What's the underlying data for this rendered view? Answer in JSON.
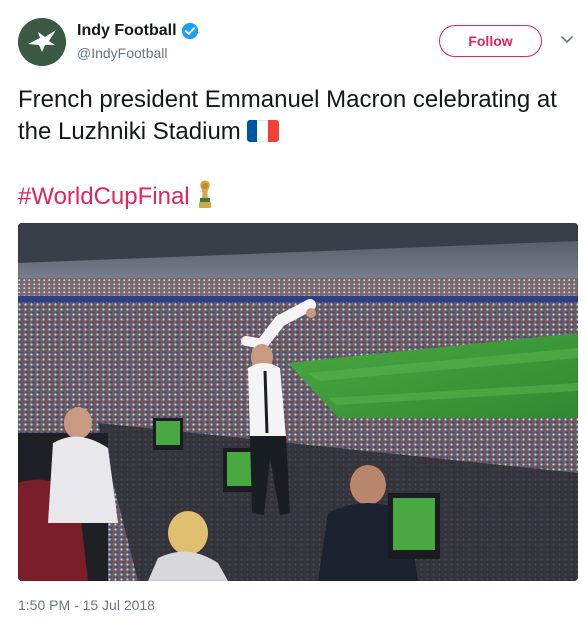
{
  "tweet": {
    "author": {
      "display_name": "Indy Football",
      "handle": "@IndyFootball",
      "verified": true,
      "avatar_icon": "eagle-logo-icon"
    },
    "follow_label": "Follow",
    "text": "French president Emmanuel Macron celebrating at the Luzhniki Stadium",
    "flag_icon": "france-flag-icon",
    "hashtag": "#WorldCupFinal",
    "trophy_icon": "world-cup-trophy-icon",
    "timestamp": "1:50 PM - 15 Jul 2018"
  },
  "colors": {
    "accent": "#e0245e",
    "verified_blue": "#1da1f2",
    "muted_text": "#657786",
    "pitch_green": "#3f9b3a"
  }
}
